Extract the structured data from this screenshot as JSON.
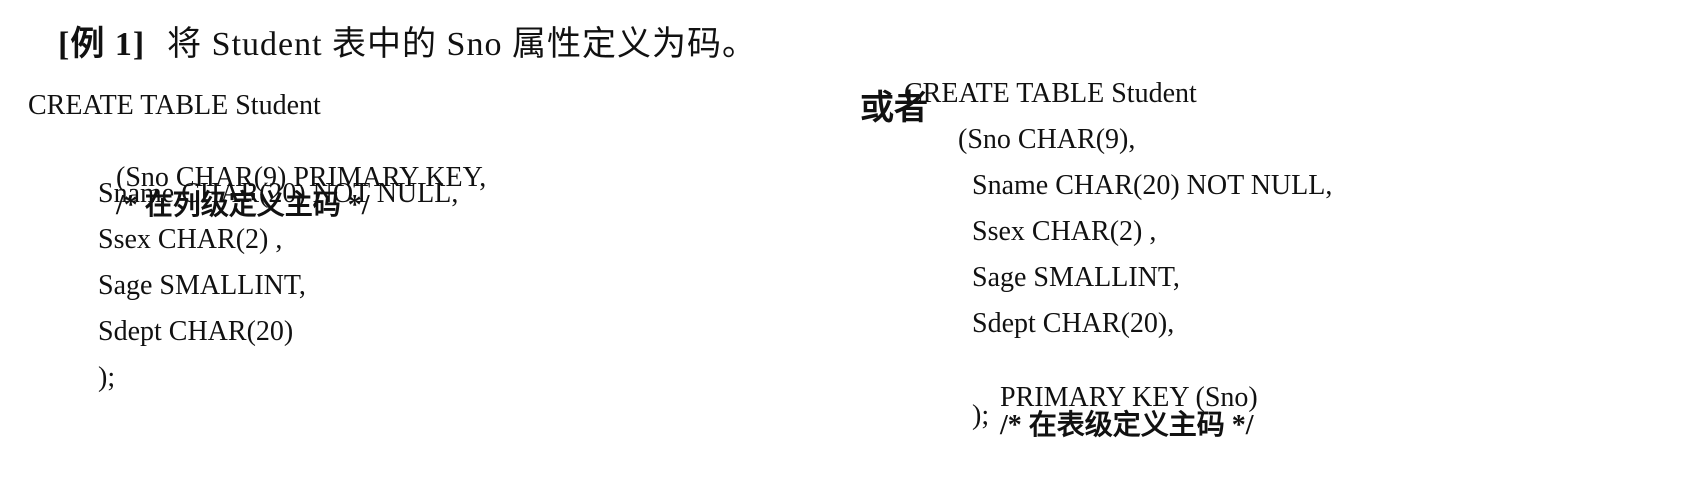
{
  "example": {
    "tag": "[例 1]",
    "text": "将 Student 表中的 Sno 属性定义为码。"
  },
  "or_word": "或者",
  "left_code": {
    "line1": "CREATE TABLE Student",
    "line2": "(Sno CHAR(9) PRIMARY KEY,",
    "line2_comment": "/* 在列级定义主码 */",
    "line3": "Sname CHAR(20) NOT NULL,",
    "line4": "Ssex CHAR(2) ,",
    "line5": "Sage SMALLINT,",
    "line6": "Sdept CHAR(20)",
    "line7": ");"
  },
  "right_code": {
    "line1": "CREATE TABLE Student",
    "line2": "(Sno CHAR(9),",
    "line3": "Sname CHAR(20) NOT NULL,",
    "line4": "Ssex CHAR(2) ,",
    "line5": "Sage SMALLINT,",
    "line6": "Sdept CHAR(20),",
    "line7": "PRIMARY KEY (Sno)",
    "line7_comment": "/* 在表级定义主码 */",
    "line8": ");"
  }
}
